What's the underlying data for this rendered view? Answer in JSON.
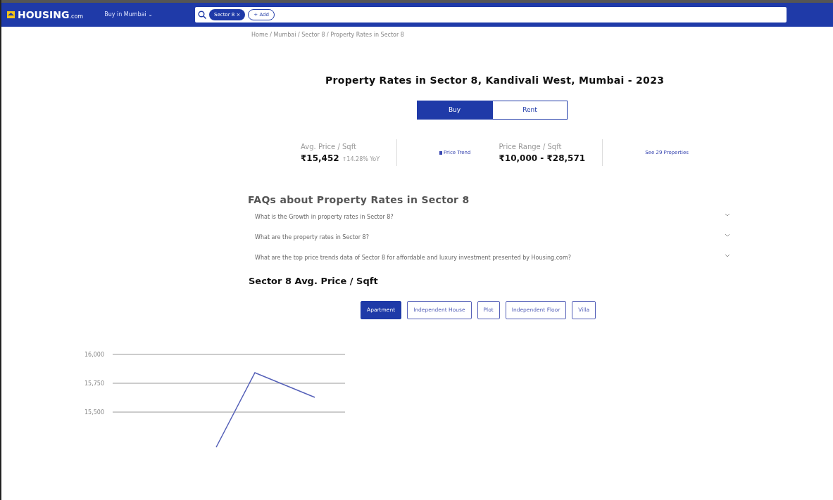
{
  "header": {
    "logo": "HOUSING",
    "logo_suffix": ".com",
    "city_menu": "Buy in Mumbai ⌄",
    "search_chips": [
      {
        "label": "Sector 8",
        "close": "×"
      }
    ],
    "add_button": "+ Add"
  },
  "breadcrumb": "Home / Mumbai / Sector 8 / Property Rates in Sector 8",
  "title": "Property Rates in Sector 8, Kandivali West, Mumbai - 2023",
  "mode_tabs": [
    {
      "label": "Buy",
      "selected": true
    },
    {
      "label": "Rent",
      "selected": false
    }
  ],
  "stats": [
    {
      "label": "Avg. Price / Sqft",
      "value": "₹15,452",
      "change": "↑14.28% YoY",
      "link": "Price Trend"
    },
    {
      "label": "Price Range / Sqft",
      "value": "₹10,000 - ₹28,571",
      "link": "See 29 Properties"
    }
  ],
  "faq_title": "FAQs about Property Rates in Sector 8",
  "faqs": [
    {
      "question": "What is the Growth in property rates in Sector 8?"
    },
    {
      "question": "What are the property rates in Sector 8?"
    },
    {
      "question": "What are the top price trends data of Sector 8 for affordable and luxury investment presented by Housing.com?"
    }
  ],
  "price_title": "Sector 8 Avg. Price / Sqft",
  "property_types": [
    {
      "label": "Apartment",
      "selected": true
    },
    {
      "label": "Independent House",
      "selected": false
    },
    {
      "label": "Plot",
      "selected": false
    },
    {
      "label": "Independent Floor",
      "selected": false
    },
    {
      "label": "Villa",
      "selected": false
    }
  ],
  "chart": {
    "y_labels": [
      "16,000",
      "15,750",
      "15,500"
    ]
  }
}
